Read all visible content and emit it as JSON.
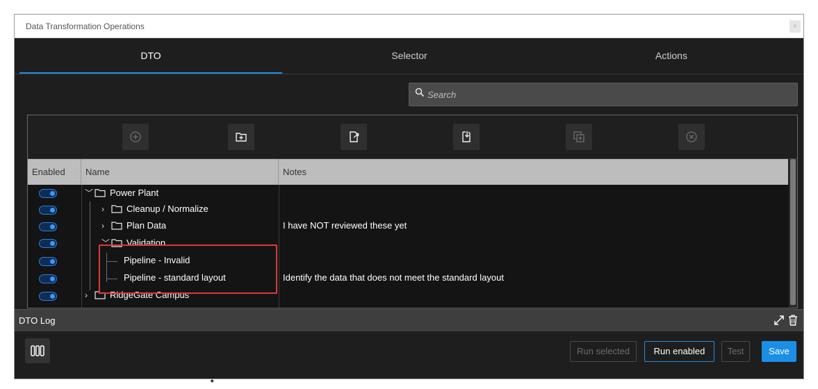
{
  "window": {
    "title": "Data Transformation Operations",
    "close_label": "×"
  },
  "tabs": [
    {
      "label": "DTO",
      "active": true
    },
    {
      "label": "Selector",
      "active": false
    },
    {
      "label": "Actions",
      "active": false
    }
  ],
  "search": {
    "placeholder": "Search"
  },
  "toolbar": {
    "buttons": [
      {
        "icon": "add-circle-icon",
        "enabled": false
      },
      {
        "icon": "add-folder-icon",
        "enabled": true
      },
      {
        "icon": "export-icon",
        "enabled": true
      },
      {
        "icon": "import-icon",
        "enabled": true
      },
      {
        "icon": "duplicate-icon",
        "enabled": false
      },
      {
        "icon": "delete-circle-icon",
        "enabled": false
      }
    ]
  },
  "grid": {
    "columns": [
      "Enabled",
      "Name",
      "Notes"
    ],
    "rows": [
      {
        "enabled": true,
        "name": "Power Plant",
        "type": "folder",
        "expanded": true,
        "level": 0,
        "notes": ""
      },
      {
        "enabled": true,
        "name": "Cleanup / Normalize",
        "type": "folder",
        "expanded": false,
        "level": 1,
        "notes": ""
      },
      {
        "enabled": true,
        "name": "Plan Data",
        "type": "folder",
        "expanded": false,
        "level": 1,
        "notes": "I have NOT reviewed these yet"
      },
      {
        "enabled": true,
        "name": "Validation",
        "type": "folder",
        "expanded": true,
        "level": 1,
        "notes": ""
      },
      {
        "enabled": true,
        "name": "Pipeline - Invalid",
        "type": "item",
        "level": 2,
        "notes": ""
      },
      {
        "enabled": true,
        "name": "Pipeline - standard layout",
        "type": "item",
        "level": 2,
        "notes": "Identify the data that does not meet the standard layout"
      },
      {
        "enabled": true,
        "name": "RidgeGate Campus",
        "type": "folder",
        "expanded": false,
        "level": 0,
        "notes": ""
      }
    ]
  },
  "log": {
    "label": "DTO Log"
  },
  "buttons": {
    "run_selected": "Run selected",
    "run_enabled": "Run enabled",
    "test": "Test",
    "save": "Save"
  },
  "colors": {
    "accent": "#1b8fe6",
    "highlight": "#e03838"
  }
}
